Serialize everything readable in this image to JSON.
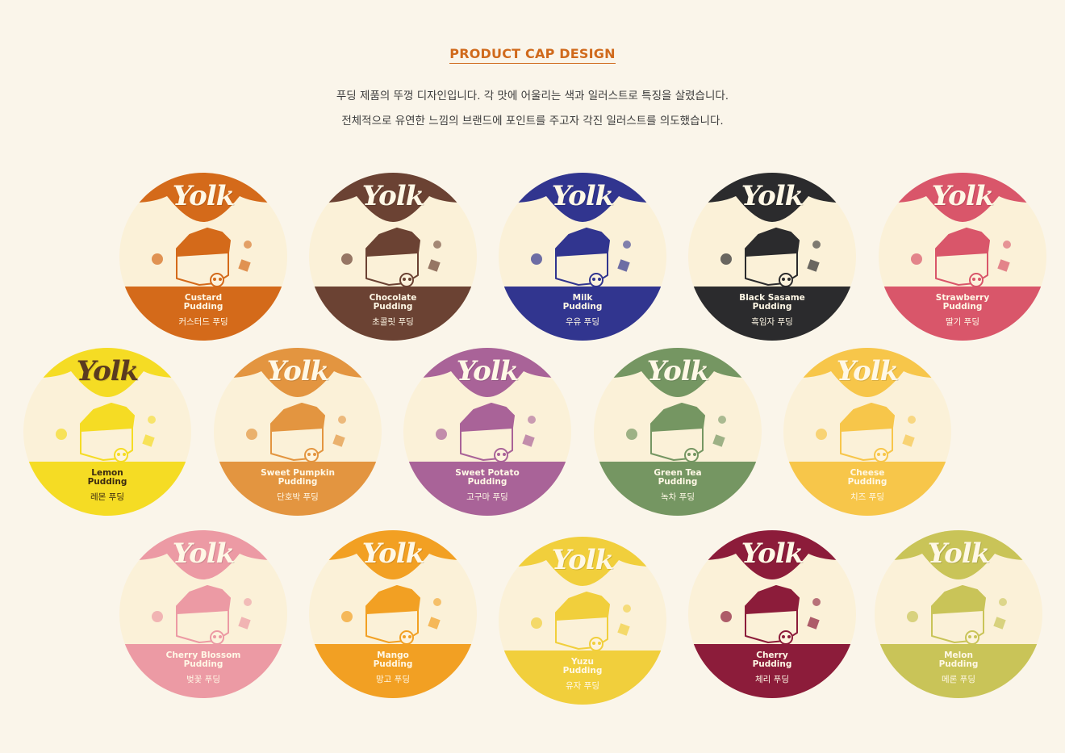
{
  "header": {
    "title": "PRODUCT CAP DESIGN",
    "desc_line1": "푸딩 제품의 뚜껑 디자인입니다. 각 맛에 어울리는 색과 일러스트로 특징을 살렸습니다.",
    "desc_line2": "전체적으로 유연한 느낌의 브랜드에 포인트를 주고자 각진 일러스트를 의도했습니다."
  },
  "brand": "Yolk",
  "caps": [
    {
      "en": "Custard\nPudding",
      "ko": "커스터드 푸딩",
      "color": "#d46a1a",
      "icon": "custard-icon"
    },
    {
      "en": "Chocolate\nPudding",
      "ko": "초콜릿 푸딩",
      "color": "#6b4233",
      "icon": "chocolate-icon"
    },
    {
      "en": "Milk\nPudding",
      "ko": "우유 푸딩",
      "color": "#31358f",
      "icon": "milk-splash-icon"
    },
    {
      "en": "Black Sasame\nPudding",
      "ko": "흑임자 푸딩",
      "color": "#2b2b2d",
      "icon": "sesame-icon"
    },
    {
      "en": "Strawberry\nPudding",
      "ko": "딸기 푸딩",
      "color": "#d9566a",
      "icon": "strawberry-icon"
    },
    {
      "en": "Lemon\nPudding",
      "ko": "레몬 푸딩",
      "color": "#f5dc24",
      "icon": "lemon-icon",
      "dark": true
    },
    {
      "en": "Sweet Pumpkin\nPudding",
      "ko": "단호박 푸딩",
      "color": "#e39540",
      "icon": "pumpkin-icon"
    },
    {
      "en": "Sweet Potato\nPudding",
      "ko": "고구마 푸딩",
      "color": "#a96398",
      "icon": "sweet-potato-icon"
    },
    {
      "en": "Green Tea\nPudding",
      "ko": "녹차 푸딩",
      "color": "#759662",
      "icon": "tea-leaf-icon"
    },
    {
      "en": "Cheese\nPudding",
      "ko": "치즈 푸딩",
      "color": "#f7c64a",
      "icon": "cheese-icon"
    },
    {
      "en": "Cherry Blossom\nPudding",
      "ko": "벚꽃 푸딩",
      "color": "#ec9aa4",
      "icon": "cherry-blossom-icon"
    },
    {
      "en": "Mango\nPudding",
      "ko": "망고 푸딩",
      "color": "#f2a023",
      "icon": "mango-icon"
    },
    {
      "en": "Yuzu\nPudding",
      "ko": "유자 푸딩",
      "color": "#f1cf3c",
      "icon": "yuzu-icon"
    },
    {
      "en": "Cherry\nPudding",
      "ko": "체리 푸딩",
      "color": "#8c1c3a",
      "icon": "cherry-icon"
    },
    {
      "en": "Melon\nPudding",
      "ko": "메론 푸딩",
      "color": "#c9c458",
      "icon": "melon-icon"
    }
  ]
}
